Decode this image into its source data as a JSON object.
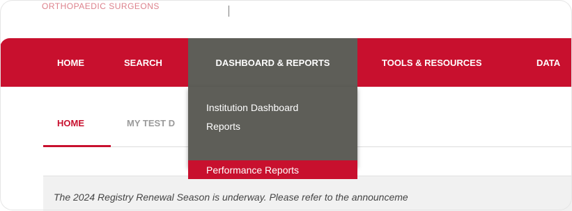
{
  "header": {
    "brand": "ORTHOPAEDIC SURGEONS"
  },
  "nav": {
    "items": [
      "HOME",
      "SEARCH",
      "DASHBOARD & REPORTS",
      "TOOLS & RESOURCES",
      "DATA"
    ],
    "active": "DASHBOARD & REPORTS"
  },
  "dropdown": {
    "items": [
      "Institution Dashboard",
      "Reports",
      "Performance Reports"
    ],
    "selected": "Performance Reports"
  },
  "tabs": {
    "items": [
      "HOME",
      "MY TEST D"
    ],
    "active": "HOME"
  },
  "notice": {
    "text": "The 2024 Registry Renewal Season is underway. Please refer to the announceme"
  },
  "colors": {
    "brand_red": "#c8102e",
    "nav_active_gray": "#5e5e58",
    "notice_bg": "#f1f1f1"
  }
}
